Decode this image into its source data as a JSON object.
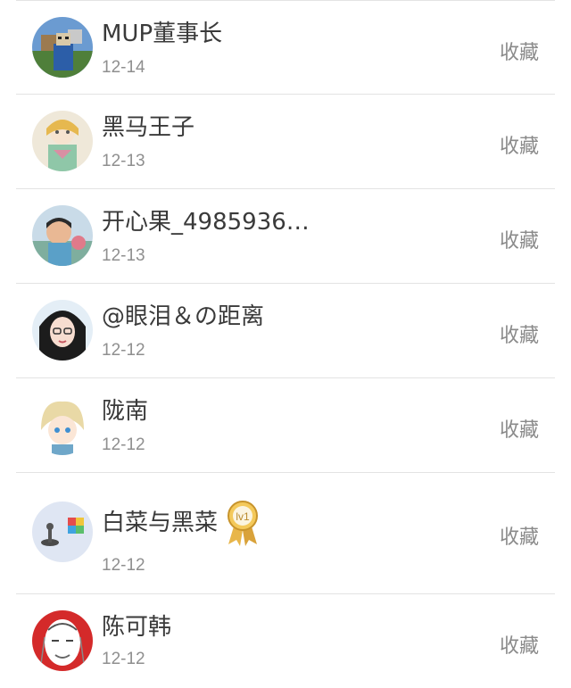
{
  "rows": [
    {
      "name": "MUP董事长",
      "date": "12-14",
      "action": "收藏",
      "avatar": "minecraft-character-avatar"
    },
    {
      "name": "黑马王子",
      "date": "12-13",
      "action": "收藏",
      "avatar": "anime-girl-avatar"
    },
    {
      "name": "开心果_4985936…",
      "date": "12-13",
      "action": "收藏",
      "avatar": "child-photo-avatar"
    },
    {
      "name": "@眼泪＆の距离",
      "date": "12-12",
      "action": "收藏",
      "avatar": "glasses-girl-avatar"
    },
    {
      "name": "陇南",
      "date": "12-12",
      "action": "收藏",
      "avatar": "blond-boy-avatar"
    },
    {
      "name": "白菜与黑菜",
      "date": "12-12",
      "action": "收藏",
      "avatar": "game-pieces-avatar",
      "badge": "lv1",
      "badge_icon": "medal-icon"
    },
    {
      "name": "陈可韩",
      "date": "12-12",
      "action": "收藏",
      "avatar": "red-sketch-avatar"
    }
  ]
}
